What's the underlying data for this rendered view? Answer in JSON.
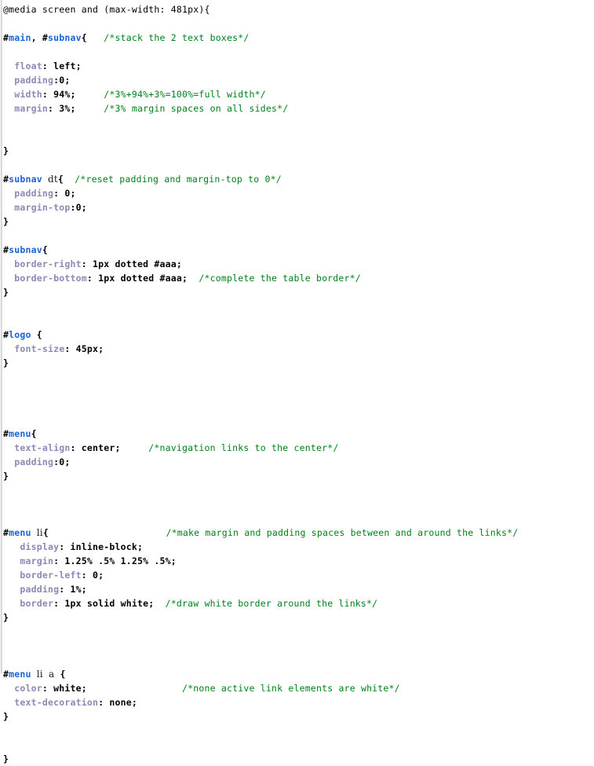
{
  "document": {
    "kind": "css-source-listing",
    "language": "CSS",
    "colors": {
      "background": "#ffffff",
      "plain_text": "#000000",
      "id_selector": "#1b62d6",
      "element_selector": "#1a1a1a",
      "property": "#8a8ab5",
      "value": "#000000",
      "comment": "#00801a",
      "gutter": "#c9c9c9"
    }
  },
  "lines": [
    {
      "n": 1,
      "parts": [
        {
          "t": "plain",
          "s": "@media screen and (max-width: 481px){"
        }
      ]
    },
    {
      "n": 2,
      "parts": []
    },
    {
      "n": 3,
      "parts": [
        {
          "t": "hash",
          "s": "#"
        },
        {
          "t": "sel-id",
          "s": "main"
        },
        {
          "t": "punct",
          "s": ", "
        },
        {
          "t": "hash",
          "s": "#"
        },
        {
          "t": "sel-id",
          "s": "subnav"
        },
        {
          "t": "brace",
          "s": "{"
        },
        {
          "t": "plain",
          "s": "   "
        },
        {
          "t": "cmt",
          "s": "/*stack the 2 text boxes*/"
        }
      ]
    },
    {
      "n": 4,
      "parts": []
    },
    {
      "n": 5,
      "parts": [
        {
          "t": "plain",
          "s": "  "
        },
        {
          "t": "prop",
          "s": "float"
        },
        {
          "t": "val",
          "s": ": left;"
        }
      ]
    },
    {
      "n": 6,
      "parts": [
        {
          "t": "plain",
          "s": "  "
        },
        {
          "t": "prop",
          "s": "padding"
        },
        {
          "t": "val",
          "s": ":0;"
        }
      ]
    },
    {
      "n": 7,
      "parts": [
        {
          "t": "plain",
          "s": "  "
        },
        {
          "t": "prop",
          "s": "width"
        },
        {
          "t": "val",
          "s": ": 94%;"
        },
        {
          "t": "plain",
          "s": "     "
        },
        {
          "t": "cmt",
          "s": "/*3%+94%+3%=100%=full width*/"
        }
      ]
    },
    {
      "n": 8,
      "parts": [
        {
          "t": "plain",
          "s": "  "
        },
        {
          "t": "prop",
          "s": "margin"
        },
        {
          "t": "val",
          "s": ": 3%;"
        },
        {
          "t": "plain",
          "s": "     "
        },
        {
          "t": "cmt",
          "s": "/*3% margin spaces on all sides*/"
        }
      ]
    },
    {
      "n": 9,
      "parts": []
    },
    {
      "n": 10,
      "parts": []
    },
    {
      "n": 11,
      "parts": [
        {
          "t": "brace",
          "s": "}"
        }
      ]
    },
    {
      "n": 12,
      "parts": []
    },
    {
      "n": 13,
      "parts": [
        {
          "t": "hash",
          "s": "#"
        },
        {
          "t": "sel-id",
          "s": "subnav"
        },
        {
          "t": "plain",
          "s": " "
        },
        {
          "t": "sel-el",
          "s": "dt"
        },
        {
          "t": "brace",
          "s": "{"
        },
        {
          "t": "plain",
          "s": "  "
        },
        {
          "t": "cmt",
          "s": "/*reset padding and margin-top to 0*/"
        }
      ]
    },
    {
      "n": 14,
      "parts": [
        {
          "t": "plain",
          "s": "  "
        },
        {
          "t": "prop",
          "s": "padding"
        },
        {
          "t": "val",
          "s": ": 0;"
        }
      ]
    },
    {
      "n": 15,
      "parts": [
        {
          "t": "plain",
          "s": "  "
        },
        {
          "t": "prop",
          "s": "margin-top"
        },
        {
          "t": "val",
          "s": ":0;"
        }
      ]
    },
    {
      "n": 16,
      "parts": [
        {
          "t": "brace",
          "s": "}"
        }
      ]
    },
    {
      "n": 17,
      "parts": []
    },
    {
      "n": 18,
      "parts": [
        {
          "t": "hash",
          "s": "#"
        },
        {
          "t": "sel-id",
          "s": "subnav"
        },
        {
          "t": "brace",
          "s": "{"
        }
      ]
    },
    {
      "n": 19,
      "parts": [
        {
          "t": "plain",
          "s": "  "
        },
        {
          "t": "prop",
          "s": "border-right"
        },
        {
          "t": "val",
          "s": ": 1px dotted #aaa;"
        }
      ]
    },
    {
      "n": 20,
      "parts": [
        {
          "t": "plain",
          "s": "  "
        },
        {
          "t": "prop",
          "s": "border-bottom"
        },
        {
          "t": "val",
          "s": ": 1px dotted #aaa;"
        },
        {
          "t": "plain",
          "s": "  "
        },
        {
          "t": "cmt",
          "s": "/*complete the table border*/"
        }
      ]
    },
    {
      "n": 21,
      "parts": [
        {
          "t": "brace",
          "s": "}"
        }
      ]
    },
    {
      "n": 22,
      "parts": []
    },
    {
      "n": 23,
      "parts": []
    },
    {
      "n": 24,
      "parts": [
        {
          "t": "hash",
          "s": "#"
        },
        {
          "t": "sel-id",
          "s": "logo"
        },
        {
          "t": "plain",
          "s": " "
        },
        {
          "t": "brace",
          "s": "{"
        }
      ]
    },
    {
      "n": 25,
      "parts": [
        {
          "t": "plain",
          "s": "  "
        },
        {
          "t": "prop",
          "s": "font-size"
        },
        {
          "t": "val",
          "s": ": 45px;"
        }
      ]
    },
    {
      "n": 26,
      "parts": [
        {
          "t": "brace",
          "s": "}"
        }
      ]
    },
    {
      "n": 27,
      "parts": []
    },
    {
      "n": 28,
      "parts": []
    },
    {
      "n": 29,
      "parts": []
    },
    {
      "n": 30,
      "parts": []
    },
    {
      "n": 31,
      "parts": [
        {
          "t": "hash",
          "s": "#"
        },
        {
          "t": "sel-id",
          "s": "menu"
        },
        {
          "t": "brace",
          "s": "{"
        }
      ]
    },
    {
      "n": 32,
      "parts": [
        {
          "t": "plain",
          "s": "  "
        },
        {
          "t": "prop",
          "s": "text-align"
        },
        {
          "t": "val",
          "s": ": center;"
        },
        {
          "t": "plain",
          "s": "     "
        },
        {
          "t": "cmt",
          "s": "/*navigation links to the center*/"
        }
      ]
    },
    {
      "n": 33,
      "parts": [
        {
          "t": "plain",
          "s": "  "
        },
        {
          "t": "prop",
          "s": "padding"
        },
        {
          "t": "val",
          "s": ":0;"
        }
      ]
    },
    {
      "n": 34,
      "parts": [
        {
          "t": "brace",
          "s": "}"
        }
      ]
    },
    {
      "n": 35,
      "parts": []
    },
    {
      "n": 36,
      "parts": []
    },
    {
      "n": 37,
      "parts": []
    },
    {
      "n": 38,
      "parts": [
        {
          "t": "hash",
          "s": "#"
        },
        {
          "t": "sel-id",
          "s": "menu"
        },
        {
          "t": "plain",
          "s": " "
        },
        {
          "t": "sel-el",
          "s": "li"
        },
        {
          "t": "brace",
          "s": "{"
        },
        {
          "t": "plain",
          "s": "                     "
        },
        {
          "t": "cmt",
          "s": "/*make margin and padding spaces between and around the links*/"
        }
      ]
    },
    {
      "n": 39,
      "parts": [
        {
          "t": "plain",
          "s": "   "
        },
        {
          "t": "prop",
          "s": "display"
        },
        {
          "t": "val",
          "s": ": inline-block;"
        }
      ]
    },
    {
      "n": 40,
      "parts": [
        {
          "t": "plain",
          "s": "   "
        },
        {
          "t": "prop",
          "s": "margin"
        },
        {
          "t": "val",
          "s": ": 1.25% .5% 1.25% .5%;"
        }
      ]
    },
    {
      "n": 41,
      "parts": [
        {
          "t": "plain",
          "s": "   "
        },
        {
          "t": "prop",
          "s": "border-left"
        },
        {
          "t": "val",
          "s": ": 0;"
        }
      ]
    },
    {
      "n": 42,
      "parts": [
        {
          "t": "plain",
          "s": "   "
        },
        {
          "t": "prop",
          "s": "padding"
        },
        {
          "t": "val",
          "s": ": 1%;"
        }
      ]
    },
    {
      "n": 43,
      "parts": [
        {
          "t": "plain",
          "s": "   "
        },
        {
          "t": "prop",
          "s": "border"
        },
        {
          "t": "val",
          "s": ": 1px solid white;"
        },
        {
          "t": "plain",
          "s": "  "
        },
        {
          "t": "cmt",
          "s": "/*draw white border around the links*/"
        }
      ]
    },
    {
      "n": 44,
      "parts": [
        {
          "t": "brace",
          "s": "}"
        }
      ]
    },
    {
      "n": 45,
      "parts": []
    },
    {
      "n": 46,
      "parts": []
    },
    {
      "n": 47,
      "parts": []
    },
    {
      "n": 48,
      "parts": [
        {
          "t": "hash",
          "s": "#"
        },
        {
          "t": "sel-id",
          "s": "menu"
        },
        {
          "t": "plain",
          "s": " "
        },
        {
          "t": "sel-el",
          "s": "li"
        },
        {
          "t": "plain",
          "s": " "
        },
        {
          "t": "sel-el",
          "s": "a"
        },
        {
          "t": "plain",
          "s": " "
        },
        {
          "t": "brace",
          "s": "{"
        }
      ]
    },
    {
      "n": 49,
      "parts": [
        {
          "t": "plain",
          "s": "  "
        },
        {
          "t": "prop",
          "s": "color"
        },
        {
          "t": "val",
          "s": ": white;"
        },
        {
          "t": "plain",
          "s": "                 "
        },
        {
          "t": "cmt",
          "s": "/*none active link elements are white*/"
        }
      ]
    },
    {
      "n": 50,
      "parts": [
        {
          "t": "plain",
          "s": "  "
        },
        {
          "t": "prop",
          "s": "text-decoration"
        },
        {
          "t": "val",
          "s": ": none;"
        }
      ]
    },
    {
      "n": 51,
      "parts": [
        {
          "t": "brace",
          "s": "}"
        }
      ]
    },
    {
      "n": 52,
      "parts": []
    },
    {
      "n": 53,
      "parts": []
    },
    {
      "n": 54,
      "parts": [
        {
          "t": "brace",
          "s": "}"
        }
      ]
    }
  ]
}
